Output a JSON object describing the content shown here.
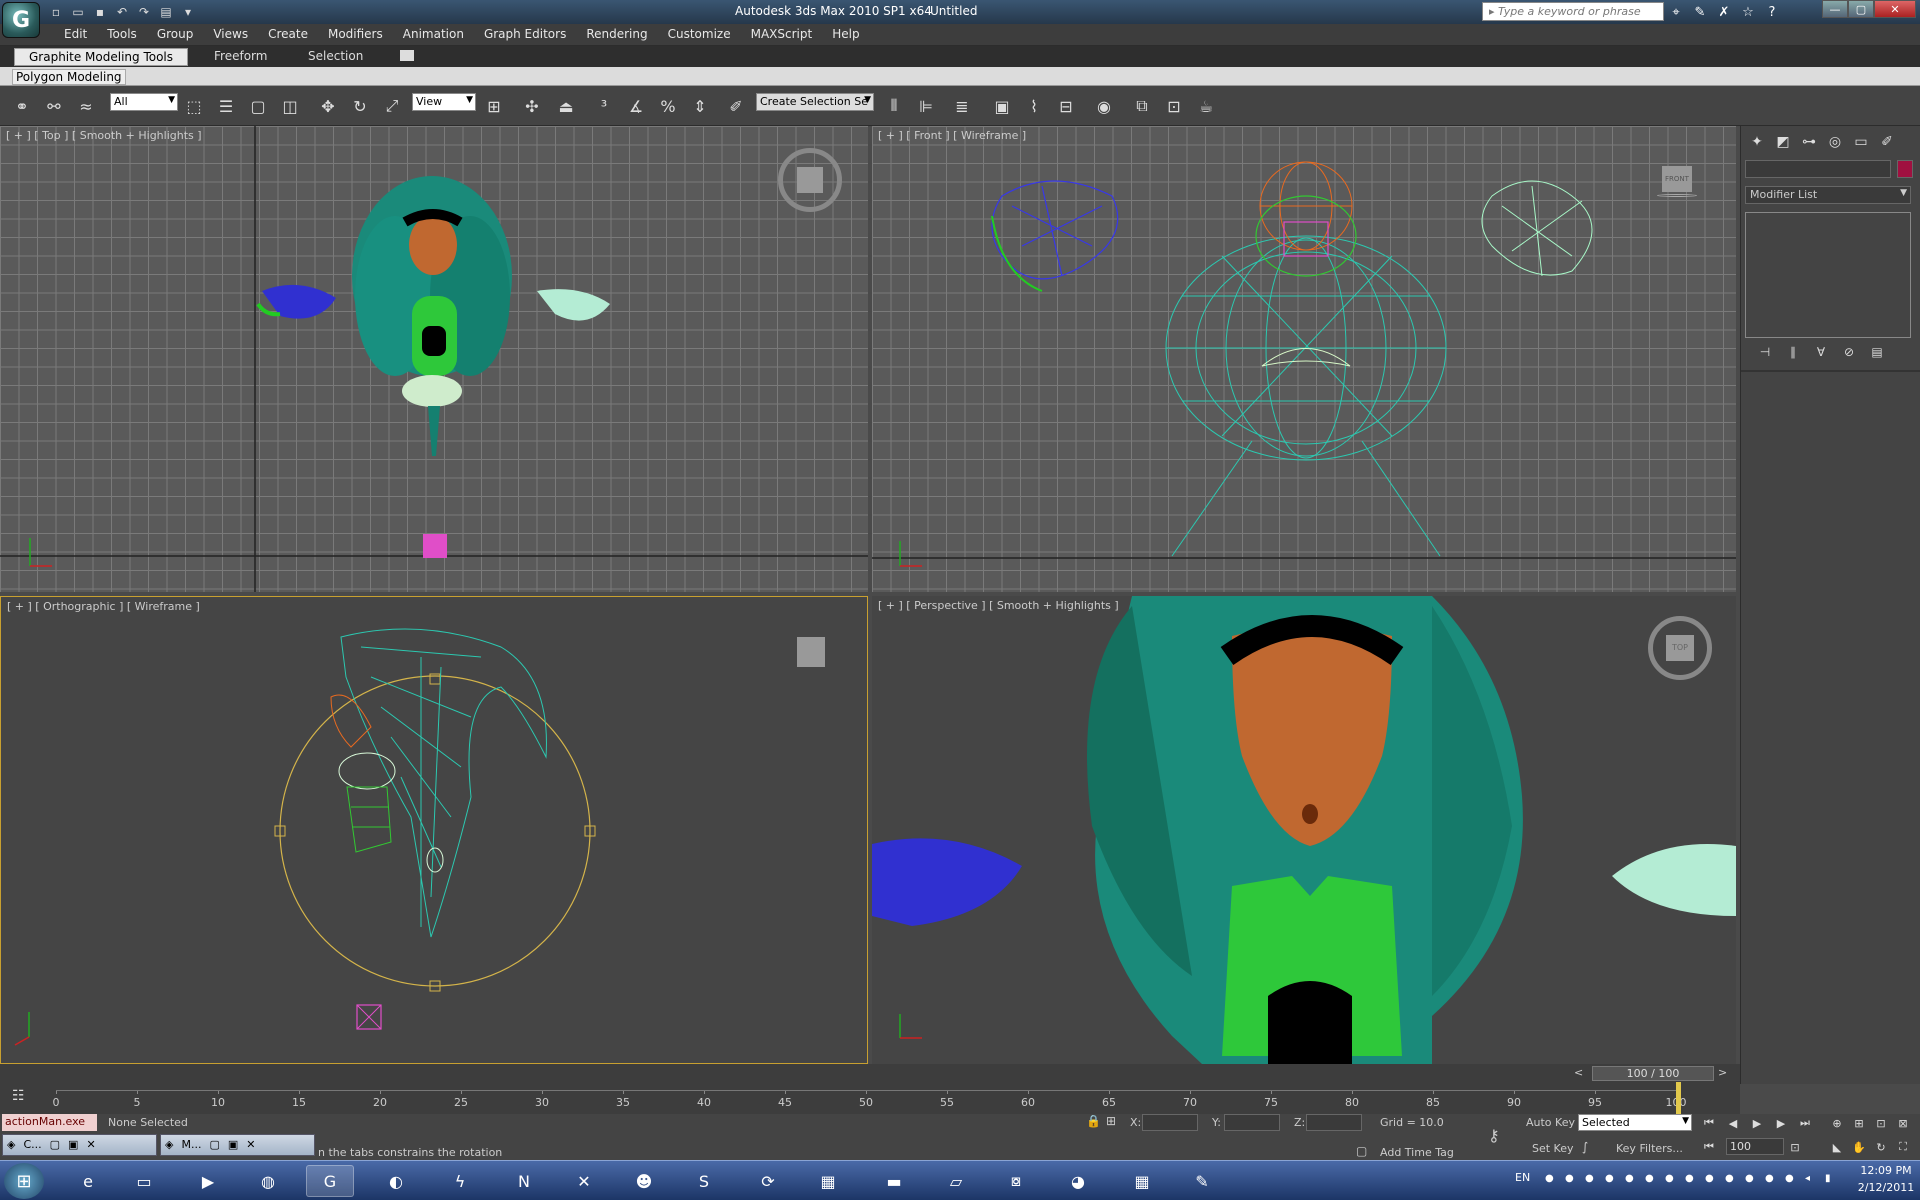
{
  "app": {
    "logo": "3ds-max-logo",
    "title": "Autodesk 3ds Max  2010 SP1 x64",
    "document": "Untitled",
    "search_placeholder": "Type a keyword or phrase"
  },
  "quick_access": [
    "new-icon",
    "open-icon",
    "save-icon",
    "undo-icon",
    "redo-icon",
    "project-folder-icon",
    "dropdown-icon"
  ],
  "title_tools": [
    "binoculars-icon",
    "wrench-icon",
    "x-icon",
    "star-icon",
    "help-icon"
  ],
  "window_controls": {
    "minimize": "—",
    "restore": "▢",
    "close": "✕"
  },
  "menu": [
    "Edit",
    "Tools",
    "Group",
    "Views",
    "Create",
    "Modifiers",
    "Animation",
    "Graph Editors",
    "Rendering",
    "Customize",
    "MAXScript",
    "Help"
  ],
  "ribbon": {
    "tabs": [
      "Graphite Modeling Tools",
      "Freeform",
      "Selection"
    ],
    "active_tab": "Graphite Modeling Tools",
    "panel_label": "Polygon Modeling"
  },
  "toolbar": {
    "selection_filter": "All",
    "ref_coord": "View",
    "named_selection": "Create Selection Se"
  },
  "viewports": {
    "top": {
      "label": "[ + ] [ Top ] [ Smooth + Highlights ]"
    },
    "front": {
      "label": "[ + ] [ Front ] [ Wireframe ]",
      "cube_label": "FRONT"
    },
    "ortho": {
      "label": "[ + ] [ Orthographic ] [ Wireframe ]"
    },
    "persp": {
      "label": "[ + ] [ Perspective ] [ Smooth + Highlights ]",
      "cube_label": "TOP"
    }
  },
  "command_panel": {
    "tabs": [
      "create-icon",
      "modify-icon",
      "hierarchy-icon",
      "motion-icon",
      "display-icon",
      "utilities-icon"
    ],
    "modifier_list": "Modifier List",
    "object_color": "#a01040"
  },
  "time_slider": {
    "label": "100 / 100",
    "prev": "<",
    "next": ">",
    "current_frame": 100,
    "total_frames": 100
  },
  "trackbar": {
    "ticks": [
      "0",
      "5",
      "10",
      "15",
      "20",
      "25",
      "30",
      "35",
      "40",
      "45",
      "50",
      "55",
      "60",
      "65",
      "70",
      "75",
      "80",
      "85",
      "90",
      "95",
      "100"
    ]
  },
  "status": {
    "maxscript": "actionMan.exe",
    "selection": "None Selected",
    "prompt": "n the tabs constrains the rotation",
    "x_label": "X:",
    "y_label": "Y:",
    "z_label": "Z:",
    "grid": "Grid = 10.0",
    "add_time_tag": "Add Time Tag",
    "auto_key": "Auto Key",
    "set_key": "Set Key",
    "selected": "Selected",
    "key_filters": "Key Filters...",
    "frame": "100"
  },
  "floating_tasks": [
    {
      "label": "C..."
    },
    {
      "label": "M..."
    }
  ],
  "taskbar": {
    "apps": [
      "ie-icon",
      "explorer-icon",
      "media-player-icon",
      "firefox-icon",
      "3dsmax-icon",
      "photoshop-icon",
      "flash-icon",
      "nuke-icon",
      "xd-icon",
      "messenger-icon",
      "skype-icon",
      "refresh-icon",
      "winrar-icon",
      "cmd-icon",
      "notepad-icon",
      "network-icon",
      "globe-icon",
      "calculator-icon",
      "paint-icon"
    ],
    "active_app": "3dsmax-icon",
    "language": "EN",
    "time": "12:09 PM",
    "date": "2/12/2011"
  },
  "colors": {
    "accent": "#a01040",
    "teal": "#1a8a7a",
    "orange": "#c06830",
    "green": "#32c832"
  }
}
